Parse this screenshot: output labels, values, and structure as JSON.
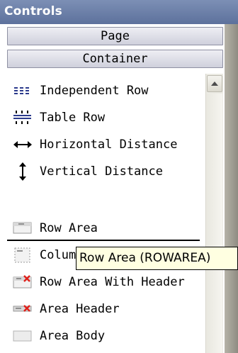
{
  "title": "Controls",
  "sections": {
    "page": "Page",
    "container": "Container"
  },
  "items": [
    {
      "label": "Independent Row",
      "icon": "independent-row-icon"
    },
    {
      "label": "Table Row",
      "icon": "table-row-icon"
    },
    {
      "label": "Horizontal Distance",
      "icon": "horizontal-arrow-icon"
    },
    {
      "label": "Vertical Distance",
      "icon": "vertical-arrow-icon"
    },
    {
      "label": "Row Area",
      "icon": "row-area-icon"
    },
    {
      "label": "Column Area",
      "icon": "column-area-icon"
    },
    {
      "label": "Row Area With Header",
      "icon": "row-area-header-icon"
    },
    {
      "label": "Area Header",
      "icon": "area-header-icon"
    },
    {
      "label": "Area Body",
      "icon": "area-body-icon"
    }
  ],
  "tooltip": "Row Area (ROWAREA)",
  "colors": {
    "title_bar": "#6b7fa8",
    "tooltip_bg": "#ffffe1",
    "icon_red": "#e0201a"
  }
}
